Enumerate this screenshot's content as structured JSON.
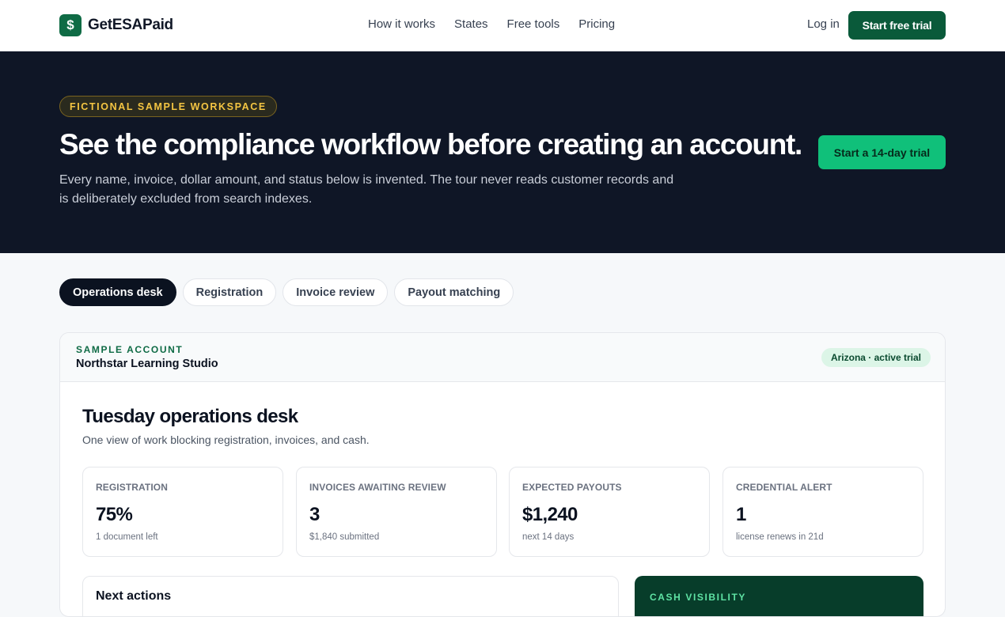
{
  "brand": {
    "logo_symbol": "$",
    "name": "GetESAPaid",
    "color": "#0f6b45"
  },
  "nav": {
    "links": [
      "How it works",
      "States",
      "Free tools",
      "Pricing"
    ],
    "login": "Log in",
    "cta": "Start free trial"
  },
  "hero": {
    "tag": "FICTIONAL SAMPLE WORKSPACE",
    "title": "See the compliance workflow before creating an account.",
    "subtitle": "Every name, invoice, dollar amount, and status below is invented. The tour never reads customer records and is deliberately excluded from search indexes.",
    "cta": "Start a 14-day trial"
  },
  "tabs": [
    {
      "label": "Operations desk",
      "active": true
    },
    {
      "label": "Registration",
      "active": false
    },
    {
      "label": "Invoice review",
      "active": false
    },
    {
      "label": "Payout matching",
      "active": false
    }
  ],
  "account": {
    "label": "SAMPLE ACCOUNT",
    "name": "Northstar Learning Studio",
    "status": "Arizona · active trial"
  },
  "desk": {
    "title": "Tuesday operations desk",
    "subtitle": "One view of work blocking registration, invoices, and cash."
  },
  "kpis": [
    {
      "label": "REGISTRATION",
      "value": "75%",
      "note": "1 document left"
    },
    {
      "label": "INVOICES AWAITING REVIEW",
      "value": "3",
      "note": "$1,840 submitted"
    },
    {
      "label": "EXPECTED PAYOUTS",
      "value": "$1,240",
      "note": "next 14 days"
    },
    {
      "label": "CREDENTIAL ALERT",
      "value": "1",
      "note": "license renews in 21d"
    }
  ],
  "next_actions": {
    "title": "Next actions"
  },
  "cash": {
    "title": "CASH VISIBILITY"
  }
}
